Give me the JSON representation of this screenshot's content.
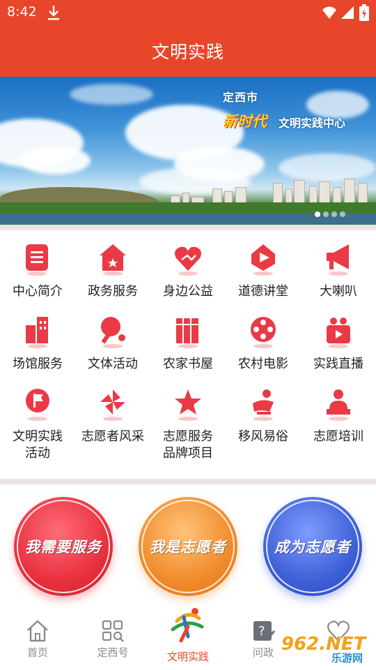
{
  "status": {
    "time": "8:42"
  },
  "appbar": {
    "title": "文明实践"
  },
  "banner": {
    "city": "定西市",
    "slogan_highlight": "新时代",
    "slogan_rest": "文明实践中心"
  },
  "grid": [
    {
      "label": "中心简介",
      "icon": "document-icon"
    },
    {
      "label": "政务服务",
      "icon": "government-icon"
    },
    {
      "label": "身边公益",
      "icon": "heart-hand-icon"
    },
    {
      "label": "道德讲堂",
      "icon": "play-lecture-icon"
    },
    {
      "label": "大喇叭",
      "icon": "megaphone-icon"
    },
    {
      "label": "场馆服务",
      "icon": "building-icon"
    },
    {
      "label": "文体活动",
      "icon": "ping-pong-icon"
    },
    {
      "label": "农家书屋",
      "icon": "books-icon"
    },
    {
      "label": "农村电影",
      "icon": "film-reel-icon"
    },
    {
      "label": "实践直播",
      "icon": "video-camera-icon"
    },
    {
      "label": "文明实践\n活动",
      "icon": "flag-icon"
    },
    {
      "label": "志愿者风采",
      "icon": "pinwheel-icon"
    },
    {
      "label": "志愿服务\n品牌项目",
      "icon": "star-icon"
    },
    {
      "label": "移风易俗",
      "icon": "reading-person-icon"
    },
    {
      "label": "志愿培训",
      "icon": "trainer-icon"
    }
  ],
  "actions": {
    "need_service": "我需要服务",
    "i_am_volunteer": "我是志愿者",
    "become_volunteer": "成为志愿者"
  },
  "nav": {
    "home": "首页",
    "dingxi": "定西号",
    "practice": "文明实践",
    "wenzheng": "问政",
    "fifth": ""
  },
  "watermark": {
    "brand": "962.NET",
    "site": "乐游网"
  },
  "colors": {
    "primary": "#e8462a",
    "icon_red": "#ea3a45",
    "btn_red": "#e8303e",
    "btn_orange": "#f08a2a",
    "btn_blue": "#3d5fd6"
  }
}
